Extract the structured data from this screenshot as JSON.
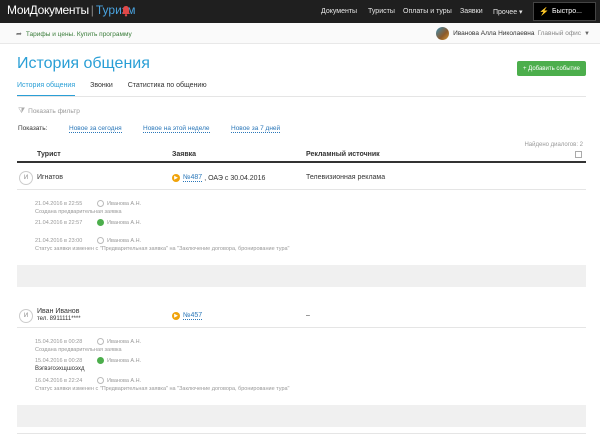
{
  "topbar": {
    "logo_main": "МоиДокументы",
    "logo_sep": "|",
    "logo_sub": "Туризм",
    "nav": [
      {
        "label": "Документы"
      },
      {
        "label": "Туристы"
      },
      {
        "label": "Оплаты и туры"
      },
      {
        "label": "Заявки"
      },
      {
        "label": "Прочее ▾"
      }
    ],
    "quick_label": "Быстро..."
  },
  "subbar": {
    "tariff_link": "Тарифы и цены. Купить программу",
    "user_name": "Иванова Алла Николаевна",
    "user_office": "Главный офис"
  },
  "page": {
    "title": "История общения",
    "add_button": "+ Добавить событие"
  },
  "tabs": [
    {
      "label": "История общения"
    },
    {
      "label": "Звонки"
    },
    {
      "label": "Статистика по общению"
    }
  ],
  "filter": {
    "toggle_label": "Показать фильтр",
    "show_label": "Показать:",
    "presets": [
      "Новое за сегодня",
      "Новое на этой неделе",
      "Новое за 7 дней"
    ]
  },
  "list": {
    "found_label": "Найдено диалогов: 2",
    "columns": {
      "tourist": "Турист",
      "request": "Заявка",
      "source": "Рекламный источник"
    },
    "rows": [
      {
        "initial": "И",
        "tourist": "Игнатов",
        "phone": "",
        "request_number": "№487",
        "request_rest": ", ОАЭ с 30.04.2016",
        "source": "Телевизионная реклама",
        "events": [
          {
            "date": "21.04.2016 в 22:55",
            "who": "Иванова А.Н.",
            "icon": "user-icon",
            "text": "Создана предварительная заявка"
          },
          {
            "date": "21.04.2016 в 22:57",
            "who": "Иванова А.Н.",
            "icon": "phone-icon",
            "text": ""
          },
          {
            "date": "21.04.2016 в 23:00",
            "who": "Иванова А.Н.",
            "icon": "user-icon",
            "text": "Статус заявки изменен с \"Предварительная заявка\" на \"Заключение договора, бронирование тура\""
          }
        ]
      },
      {
        "initial": "И",
        "tourist": "Иван Иванов",
        "phone": "тел. 8911111****",
        "request_number": "№457",
        "request_rest": "",
        "source": "–",
        "events": [
          {
            "date": "15.04.2016 в 00:28",
            "who": "Иванова А.Н.",
            "icon": "user-icon",
            "text": "Создана предварительная заявка"
          },
          {
            "date": "15.04.2016 в 00:28",
            "who": "Иванова А.Н.",
            "icon": "phone-icon",
            "text": "Вэгвэгоэхщшоэхд"
          },
          {
            "date": "16.04.2016 в 22:24",
            "who": "Иванова А.Н.",
            "icon": "user-icon",
            "text": "Статус заявки изменен с \"Предварительная заявка\" на \"Заключение договора, бронирование тура\""
          }
        ]
      }
    ]
  },
  "colors": {
    "accent": "#2a9fd6",
    "link": "#2a77b9",
    "success": "#4cae4c",
    "topbar": "#1f1f1f",
    "badge": "#f0a30a"
  }
}
